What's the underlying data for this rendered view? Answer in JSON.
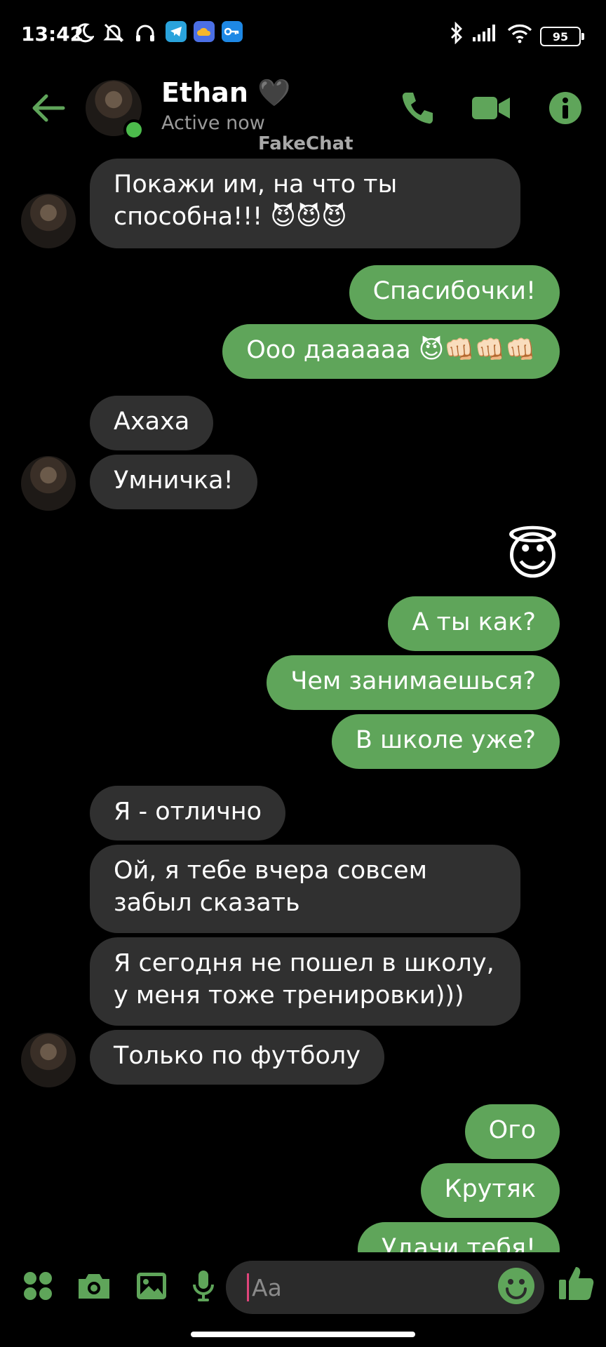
{
  "status_bar": {
    "time": "13:42",
    "battery": "95",
    "icons": [
      "moon-icon",
      "muted-bell-icon",
      "headphones-icon",
      "telegram-icon",
      "cloud-app-icon",
      "key-app-icon",
      "bluetooth-icon",
      "signal-icon",
      "wifi-icon",
      "battery-icon"
    ]
  },
  "header": {
    "contact_name": "Ethan 🖤",
    "status": "Active now",
    "watermark": "FakeChat",
    "accent": "#5fa55a"
  },
  "messages": [
    {
      "side": "in",
      "text": "Покажи им, на что ты\nспособна!!! 😈😈😈",
      "avatar": true
    },
    {
      "side": "out",
      "text": "Спасибочки!"
    },
    {
      "side": "out",
      "text": "Ооо даааааа 😈👊🏻👊🏻👊🏻"
    },
    {
      "side": "in",
      "text": "Ахаха"
    },
    {
      "side": "in",
      "text": "Умничка!",
      "avatar": true
    },
    {
      "side": "out",
      "emoji": "😇"
    },
    {
      "side": "out",
      "text": "А ты как?"
    },
    {
      "side": "out",
      "text": "Чем занимаешься?"
    },
    {
      "side": "out",
      "text": "В школе уже?"
    },
    {
      "side": "in",
      "text": "Я - отлично"
    },
    {
      "side": "in",
      "text": "Ой, я тебе вчера совсем\nзабыл сказать"
    },
    {
      "side": "in",
      "text": "Я сегодня не пошел в школу,\nу меня тоже тренировки)))"
    },
    {
      "side": "in",
      "text": "Только по футболу",
      "avatar": true
    },
    {
      "side": "out",
      "text": "Ого"
    },
    {
      "side": "out",
      "text": "Крутяк"
    },
    {
      "side": "out",
      "text": "Удачи тебя!"
    }
  ],
  "composer": {
    "placeholder": "Аа",
    "icons": [
      "apps-icon",
      "camera-icon",
      "gallery-icon",
      "microphone-icon",
      "emoji-icon",
      "thumbs-up-icon"
    ]
  }
}
